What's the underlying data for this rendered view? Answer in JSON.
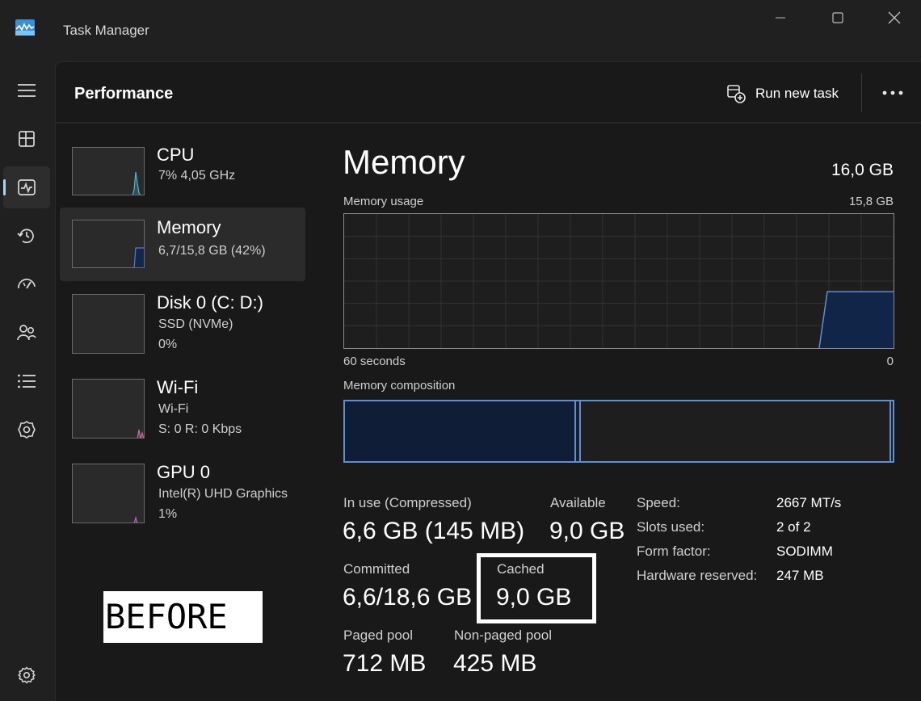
{
  "window": {
    "title": "Task Manager",
    "controls": {
      "minimize": "minimize-icon",
      "maximize": "maximize-icon",
      "close": "close-icon"
    }
  },
  "nav": {
    "items": [
      {
        "name": "menu",
        "icon": "hamburger-icon"
      },
      {
        "name": "processes",
        "icon": "processes-icon"
      },
      {
        "name": "performance",
        "icon": "performance-icon",
        "active": true
      },
      {
        "name": "app-history",
        "icon": "history-icon"
      },
      {
        "name": "startup-apps",
        "icon": "startup-icon"
      },
      {
        "name": "users",
        "icon": "users-icon"
      },
      {
        "name": "details",
        "icon": "details-icon"
      },
      {
        "name": "services",
        "icon": "services-icon"
      },
      {
        "name": "settings",
        "icon": "gear-icon"
      }
    ]
  },
  "header": {
    "title": "Performance",
    "run_new_task": "Run new task",
    "more": "more-icon"
  },
  "resources": [
    {
      "name": "CPU",
      "line1": "7%  4,05 GHz",
      "line2": ""
    },
    {
      "name": "Memory",
      "line1": "6,7/15,8 GB (42%)",
      "line2": "",
      "selected": true
    },
    {
      "name": "Disk 0 (C: D:)",
      "line1": "SSD (NVMe)",
      "line2": "0%"
    },
    {
      "name": "Wi-Fi",
      "line1": "Wi-Fi",
      "line2": "S: 0  R: 0 Kbps"
    },
    {
      "name": "GPU 0",
      "line1": "Intel(R) UHD Graphics",
      "line2": "1%"
    }
  ],
  "annotation": {
    "before": "BEFORE"
  },
  "detail": {
    "title": "Memory",
    "total": "16,0 GB",
    "usage_label": "Memory usage",
    "usage_max": "15,8 GB",
    "time_left": "60 seconds",
    "time_right": "0",
    "composition_label": "Memory composition",
    "usage_level": 0.42,
    "composition_in_use_fraction": 0.42,
    "stats": {
      "in_use_label": "In use (Compressed)",
      "in_use_value": "6,6 GB (145 MB)",
      "available_label": "Available",
      "available_value": "9,0 GB",
      "committed_label": "Committed",
      "committed_value": "6,6/18,6 GB",
      "cached_label": "Cached",
      "cached_value": "9,0 GB",
      "paged_label": "Paged pool",
      "paged_value": "712 MB",
      "nonpaged_label": "Non-paged pool",
      "nonpaged_value": "425 MB"
    },
    "specs": [
      {
        "label": "Speed:",
        "value": "2667 MT/s"
      },
      {
        "label": "Slots used:",
        "value": "2 of 2"
      },
      {
        "label": "Form factor:",
        "value": "SODIMM"
      },
      {
        "label": "Hardware reserved:",
        "value": "247 MB"
      }
    ]
  }
}
